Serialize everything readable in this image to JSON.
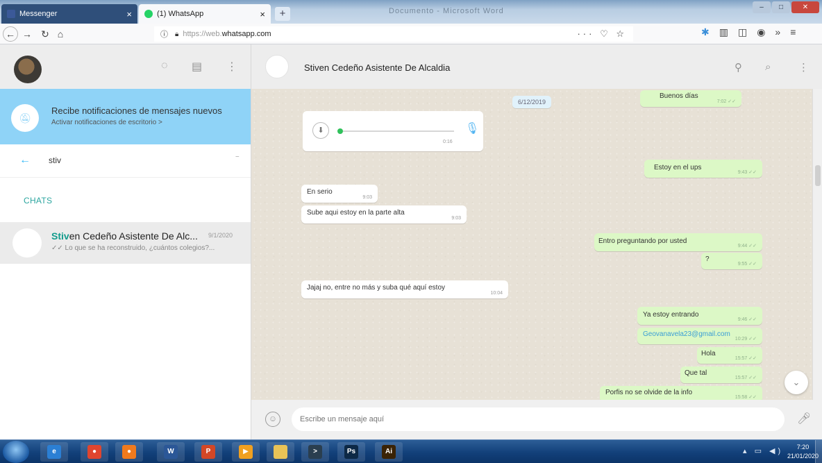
{
  "browser": {
    "tabs": [
      {
        "label": "Messenger",
        "close": "×",
        "favicon_color": "#3b5998"
      },
      {
        "label": "(1) WhatsApp",
        "close": "×",
        "favicon_color": "#25d366"
      }
    ],
    "new_tab": "+",
    "window_title": "Documento - Microsoft Word",
    "url_prefix": "https://web.",
    "url_host": "whatsapp.com",
    "url_actions": "··· ♡ ☆"
  },
  "sidebar": {
    "notification": {
      "title": "Recibe notificaciones de mensajes nuevos",
      "link": "Activar notificaciones de escritorio >"
    },
    "search": {
      "value": "stiv"
    },
    "chats_label": "CHATS",
    "chat_item": {
      "name_highlight": "Stiv",
      "name_rest": "en Cedeño Asistente De Alc...",
      "date": "9/1/2020",
      "preview": "✓✓ Lo que se ha reconstruido, ¿cuántos colegios?..."
    }
  },
  "conversation": {
    "contact_name": "Stiven Cedeño Asistente De Alcaldia",
    "date_chip": "6/12/2019",
    "voice_note": {
      "duration": "0:16"
    },
    "messages": [
      {
        "text": "Buenos días",
        "time": "7:02 ✓✓"
      },
      {
        "text": "Estoy en el ups",
        "time": "9:43 ✓✓"
      },
      {
        "text": "En serio",
        "time": "9:03"
      },
      {
        "text": "Sube aqui estoy en la parte alta",
        "time": "9:03"
      },
      {
        "text": "Entro preguntando por usted",
        "time": "9:44 ✓✓"
      },
      {
        "text": "?",
        "time": "9:55 ✓✓"
      },
      {
        "text": "Jajaj no, entre no más y suba qué aquí estoy",
        "time": "10:04"
      },
      {
        "text": "Ya estoy entrando",
        "time": "9:46 ✓✓"
      },
      {
        "text": "Geovanavela23@gmail.com",
        "time": "10:29 ✓✓"
      },
      {
        "text": "Hola",
        "time": "15:57 ✓✓"
      },
      {
        "text": "Que tal",
        "time": "15:57 ✓✓"
      },
      {
        "text": "Porfis no se olvide de la info",
        "time": "15:58 ✓✓"
      }
    ],
    "composer_placeholder": "Escribe un mensaje aquí"
  },
  "taskbar": {
    "clock_time": "7:20",
    "clock_date": "21/01/2020",
    "apps": [
      {
        "icon": "internet-explorer-icon",
        "color": "#2b7fd4",
        "glyph": "e"
      },
      {
        "icon": "chrome-icon",
        "color": "#e0452f",
        "glyph": "●"
      },
      {
        "icon": "firefox-icon",
        "color": "#f07a1d",
        "glyph": "●"
      },
      {
        "icon": "word-icon",
        "color": "#2b5797",
        "glyph": "W"
      },
      {
        "icon": "powerpoint-icon",
        "color": "#d24726",
        "glyph": "P"
      },
      {
        "icon": "media-player-icon",
        "color": "#f0a020",
        "glyph": "▶"
      },
      {
        "icon": "folder-icon",
        "color": "#e8c357",
        "glyph": ""
      },
      {
        "icon": "terminal-icon",
        "color": "#2a3e4f",
        "glyph": ">"
      },
      {
        "icon": "photoshop-icon",
        "color": "#0d2946",
        "glyph": "Ps"
      },
      {
        "icon": "illustrator-icon",
        "color": "#3a2306",
        "glyph": "Ai"
      }
    ]
  }
}
